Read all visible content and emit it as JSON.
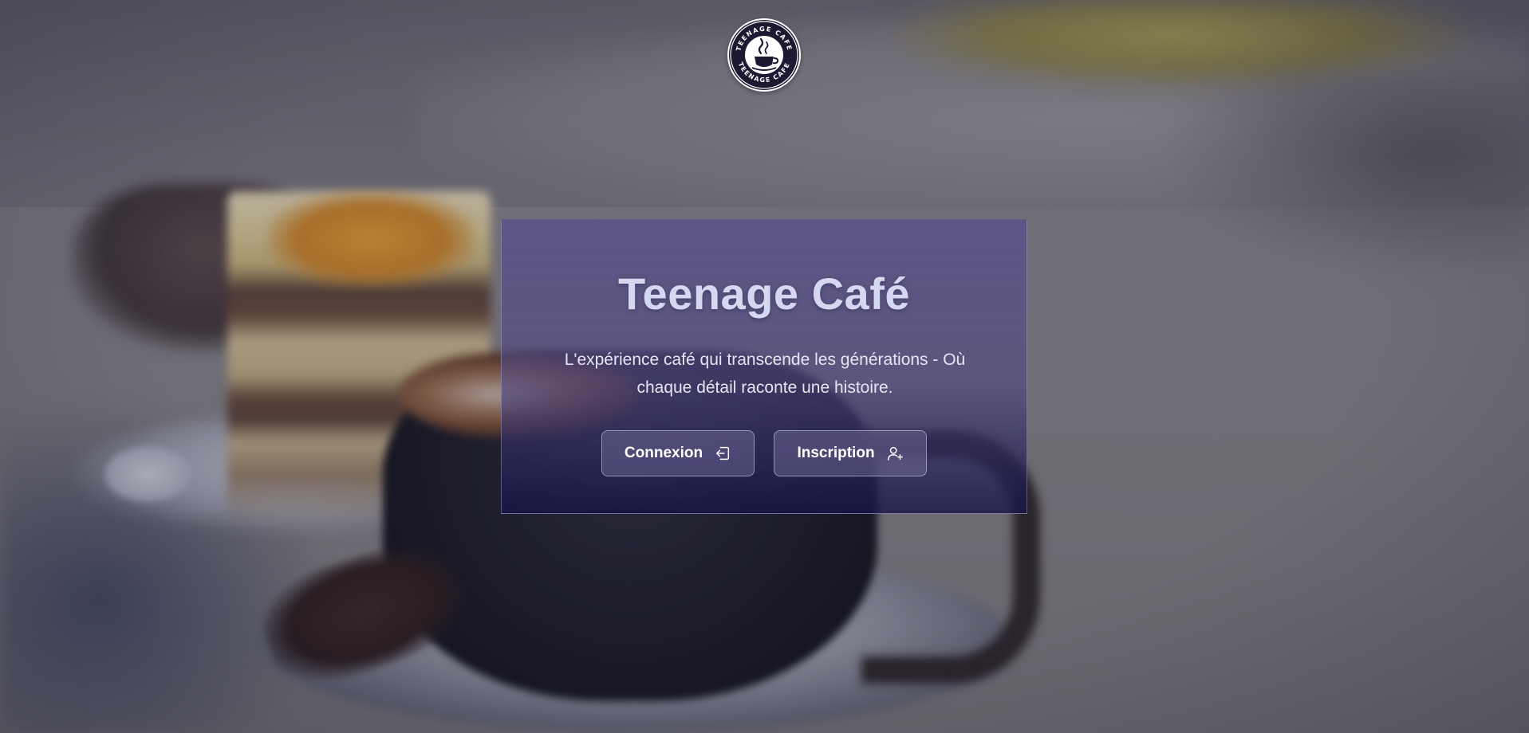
{
  "logo": {
    "ring_text": "TEENAGE CAFE",
    "colors": {
      "ring": "#1c1a33",
      "background": "#ffffff"
    }
  },
  "hero": {
    "title": "Teenage Café",
    "subtitle": "L'expérience café qui transcende les générations - Où chaque détail raconte une histoire."
  },
  "actions": {
    "login": {
      "label": "Connexion",
      "icon": "login-icon"
    },
    "signup": {
      "label": "Inscription",
      "icon": "user-plus-icon"
    }
  },
  "colors": {
    "card_top": "#564c8c",
    "card_bottom": "#161446",
    "title": "#d6d8f2",
    "button_text": "#ffffff"
  }
}
